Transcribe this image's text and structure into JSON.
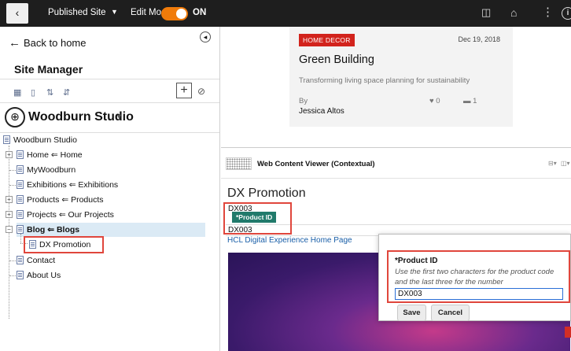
{
  "topbar": {
    "back_glyph": "‹",
    "site_label": "Published Site",
    "edit_mode_label": "Edit Mode:",
    "edit_mode_state": "ON",
    "toggle_on": true,
    "icons": [
      "preview-icon",
      "home-icon",
      "more-vertical-icon",
      "info-icon"
    ]
  },
  "sidebar": {
    "back_label": "Back to home",
    "title": "Site Manager",
    "site_name": "Woodburn Studio",
    "tree": [
      {
        "label": "Woodburn Studio"
      },
      {
        "label": "Home ⇐ Home"
      },
      {
        "label": "MyWoodburn"
      },
      {
        "label": "Exhibitions ⇐ Exhibitions"
      },
      {
        "label": "Products ⇐ Products"
      },
      {
        "label": "Projects ⇐ Our Projects"
      },
      {
        "label": "Blog ⇐ Blogs"
      },
      {
        "label": "DX Promotion"
      },
      {
        "label": "Contact"
      },
      {
        "label": "About Us"
      }
    ]
  },
  "card": {
    "tag": "HOME DECOR",
    "date": "Dec 19, 2018",
    "title": "Green Building",
    "subtitle": "Transforming living space planning for sustainability",
    "by": "By",
    "author": "Jessica Altos",
    "likes": "0",
    "comments": "1"
  },
  "viewer": {
    "title": "Web Content Viewer (Contextual)",
    "content_title": "DX Promotion",
    "field_old_value": "DX003",
    "field_tag": "*Product ID",
    "field_value": "DX003",
    "link": "HCL Digital Experience Home Page"
  },
  "popup": {
    "label": "*Product ID",
    "help": "Use the first two characters for the product code and the last three for the number",
    "input_value": "DX003",
    "save_label": "Save",
    "cancel_label": "Cancel"
  },
  "colors": {
    "topbar_bg": "#1e1e1e",
    "toggle": "#f07b0a",
    "tag_red": "#d2231c",
    "field_tag_green": "#217a6b",
    "highlight_red": "#e0463c",
    "link_blue": "#1a5fa8"
  }
}
